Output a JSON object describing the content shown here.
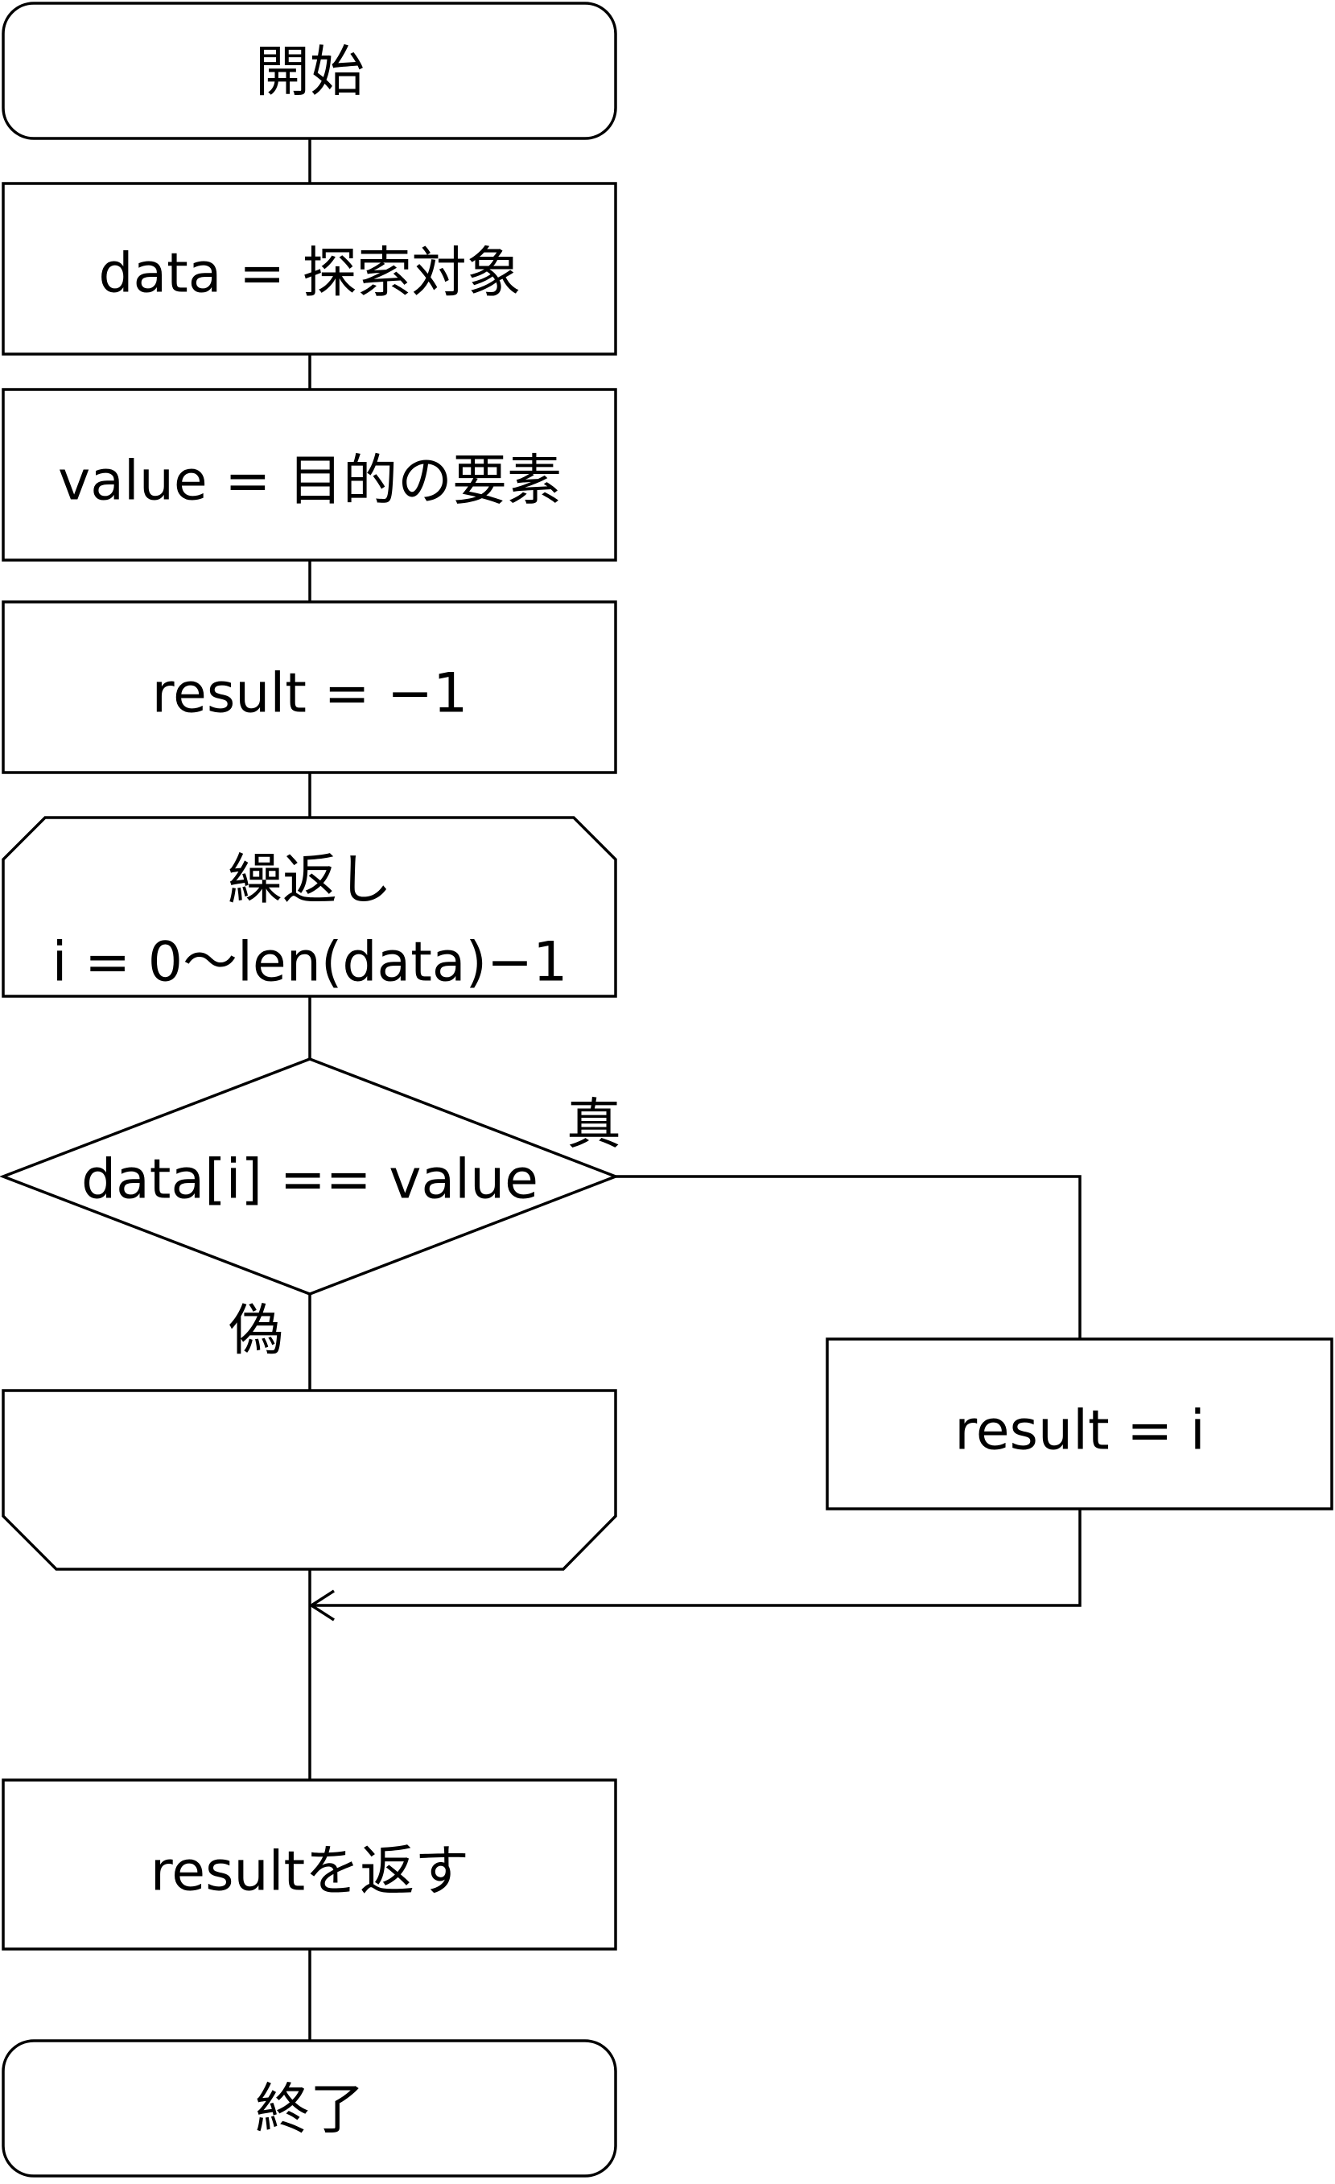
{
  "flowchart": {
    "start": "開始",
    "assign_data": "data = 探索対象",
    "assign_value": "value = 目的の要素",
    "init_result": "result = −1",
    "loop_title": "繰返し",
    "loop_range": "i = 0〜len(data)−1",
    "condition": "data[i] == value",
    "true_label": "真",
    "false_label": "偽",
    "set_result": "result = i",
    "return_result": "resultを返す",
    "end": "終了"
  }
}
